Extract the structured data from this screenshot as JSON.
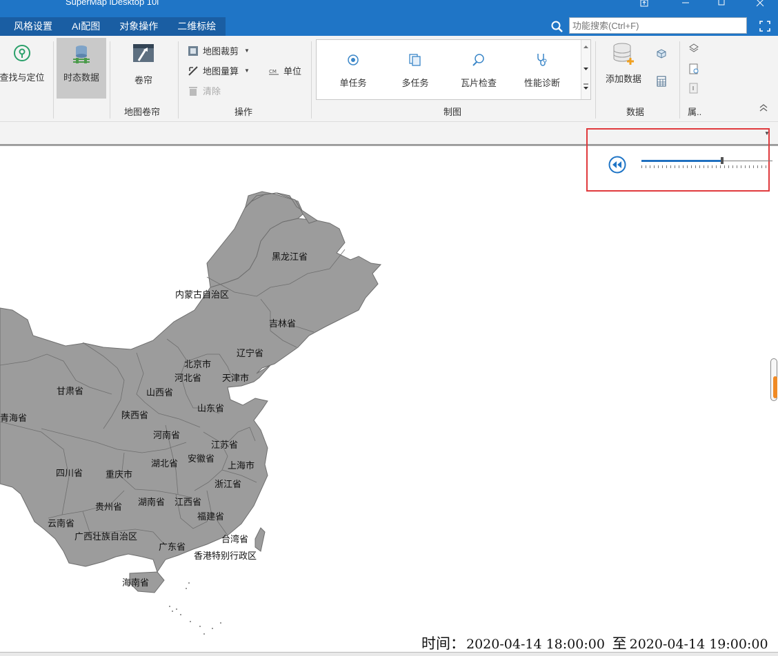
{
  "window": {
    "title": "SuperMap iDesktop 10i"
  },
  "menu": {
    "tabs": [
      "风格设置",
      "AI配图",
      "对象操作",
      "二维标绘"
    ],
    "search_placeholder": "功能搜索(Ctrl+F)"
  },
  "ribbon": {
    "find_locate": "查找与定位",
    "temporal_data": "时态数据",
    "swipe": "卷帘",
    "group_swipe": "地图卷帘",
    "clip_map": "地图裁剪",
    "measure_map": "地图量算",
    "unit": "单位",
    "clear": "清除",
    "group_operation": "操作",
    "gallery": [
      "单任务",
      "多任务",
      "瓦片检查",
      "性能诊断"
    ],
    "group_cartography": "制图",
    "add_data": "添加数据",
    "group_data": "数据",
    "group_truncated": "属.."
  },
  "map": {
    "labels": [
      "黑龙江省",
      "内蒙古自治区",
      "吉林省",
      "辽宁省",
      "北京市",
      "河北省",
      "天津市",
      "甘肃省",
      "山西省",
      "青海省",
      "陕西省",
      "山东省",
      "河南省",
      "江苏省",
      "安徽省",
      "湖北省",
      "上海市",
      "四川省",
      "重庆市",
      "浙江省",
      "贵州省",
      "湖南省",
      "江西省",
      "云南省",
      "福建省",
      "广西壮族自治区",
      "台湾省",
      "广东省",
      "香港特别行政区",
      "海南省"
    ],
    "map_fill": "#9c9c9c",
    "border_color": "#6e6e6e"
  },
  "time": {
    "label": "时间：",
    "start": "2020-04-14  18:00:00",
    "to": "至",
    "end": "2020-04-14 19:00:00",
    "slider_position": 0.63
  }
}
